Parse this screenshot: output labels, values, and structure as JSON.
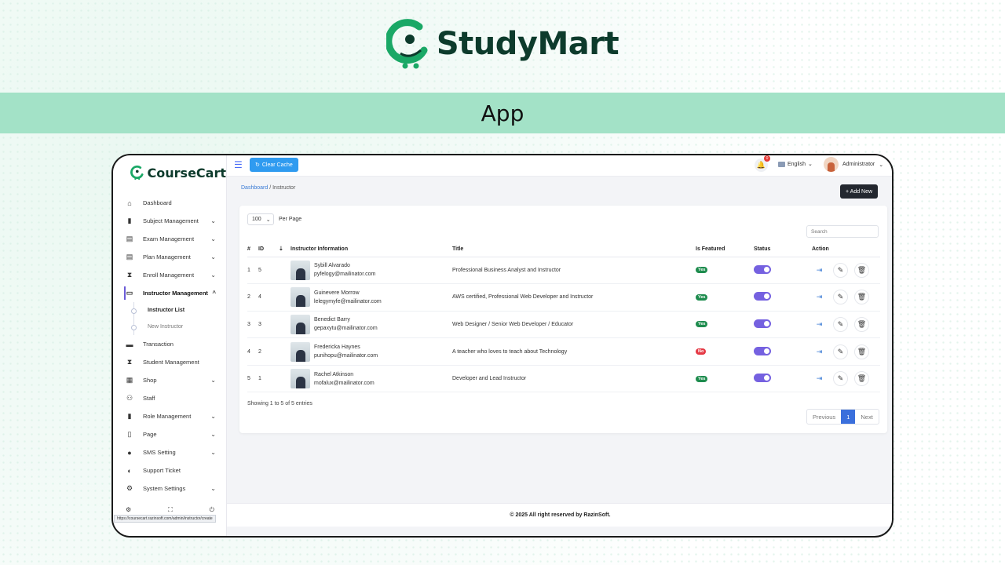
{
  "brand": {
    "name": "StudyMart",
    "band_title": "App"
  },
  "app": {
    "name": "CourseCart",
    "clear_cache": "Clear Cache",
    "notification_count": "0",
    "language": "English",
    "user": "Administrator",
    "add_new": "+ Add New",
    "footer": "© 2025 All right reserved by RazinSoft.",
    "status_url": "https://coursecart.razinsoft.com/admin/instructor/create"
  },
  "breadcrumb": {
    "home": "Dashboard",
    "sep": "/",
    "current": "Instructor"
  },
  "sidebar": {
    "items": [
      {
        "label": "Dashboard",
        "icon": "house-icon",
        "glyph": "⌂"
      },
      {
        "label": "Subject Management",
        "icon": "book-icon",
        "glyph": "▮",
        "chevron": "⌄"
      },
      {
        "label": "Exam Management",
        "icon": "exam-icon",
        "glyph": "▤",
        "chevron": "⌄"
      },
      {
        "label": "Plan Management",
        "icon": "clipboard-icon",
        "glyph": "▤",
        "chevron": "⌄"
      },
      {
        "label": "Enroll Management",
        "icon": "hourglass-icon",
        "glyph": "⧗",
        "chevron": "⌄"
      },
      {
        "label": "Instructor Management",
        "icon": "chalkboard-icon",
        "glyph": "▭",
        "chevron": "^"
      },
      {
        "label": "Transaction",
        "icon": "wallet-icon",
        "glyph": "▬"
      },
      {
        "label": "Student Management",
        "icon": "student-icon",
        "glyph": "⧗"
      },
      {
        "label": "Shop",
        "icon": "shop-icon",
        "glyph": "▦",
        "chevron": "⌄"
      },
      {
        "label": "Staff",
        "icon": "users-icon",
        "glyph": "⚇"
      },
      {
        "label": "Role Management",
        "icon": "role-icon",
        "glyph": "▮",
        "chevron": "⌄"
      },
      {
        "label": "Page",
        "icon": "page-icon",
        "glyph": "▯",
        "chevron": "⌄"
      },
      {
        "label": "SMS Setting",
        "icon": "chat-icon",
        "glyph": "●",
        "chevron": "⌄"
      },
      {
        "label": "Support Ticket",
        "icon": "headset-icon",
        "glyph": "◐"
      },
      {
        "label": "System Settings",
        "icon": "gear-icon",
        "glyph": "⚙",
        "chevron": "⌄"
      }
    ],
    "sub_items": [
      {
        "label": "Instructor List"
      },
      {
        "label": "New Instructor"
      }
    ]
  },
  "table": {
    "per_page_value": "100",
    "per_page_label": "Per Page",
    "search_placeholder": "Search",
    "headers": {
      "num": "#",
      "id": "ID",
      "sort_glyph": "⇣",
      "info": "Instructor Information",
      "title": "Title",
      "featured": "Is Featured",
      "status": "Status",
      "action": "Action"
    },
    "rows": [
      {
        "num": "1",
        "id": "5",
        "name": "Sybill Alvarado",
        "email": "pyfelogy@mailinator.com",
        "title": "Professional Business Analyst and Instructor",
        "featured": "Yes",
        "status": true
      },
      {
        "num": "2",
        "id": "4",
        "name": "Guinevere Morrow",
        "email": "lelegymyfe@mailinator.com",
        "title": "AWS certified, Professional Web Developer and Instructor",
        "featured": "Yes",
        "status": true
      },
      {
        "num": "3",
        "id": "3",
        "name": "Benedict Barry",
        "email": "gepaxytu@mailinator.com",
        "title": "Web Designer / Senior Web Developer / Educator",
        "featured": "Yes",
        "status": true
      },
      {
        "num": "4",
        "id": "2",
        "name": "Fredericka Haynes",
        "email": "punihopu@mailinator.com",
        "title": "A teacher who loves to teach about Technology",
        "featured": "No",
        "status": true
      },
      {
        "num": "5",
        "id": "1",
        "name": "Rachel Atkinson",
        "email": "mofalux@mailinator.com",
        "title": "Developer and Lead Instructor",
        "featured": "Yes",
        "status": true
      }
    ],
    "showing": "Showing 1 to 5 of 5 entries",
    "pagination": {
      "previous": "Previous",
      "current": "1",
      "next": "Next"
    }
  },
  "colors": {
    "brand_green": "#1aa866",
    "brand_dark": "#0d3b2c",
    "band": "#a3e2c7",
    "accent_purple": "#7561e0",
    "primary_blue": "#2f9bf0"
  }
}
